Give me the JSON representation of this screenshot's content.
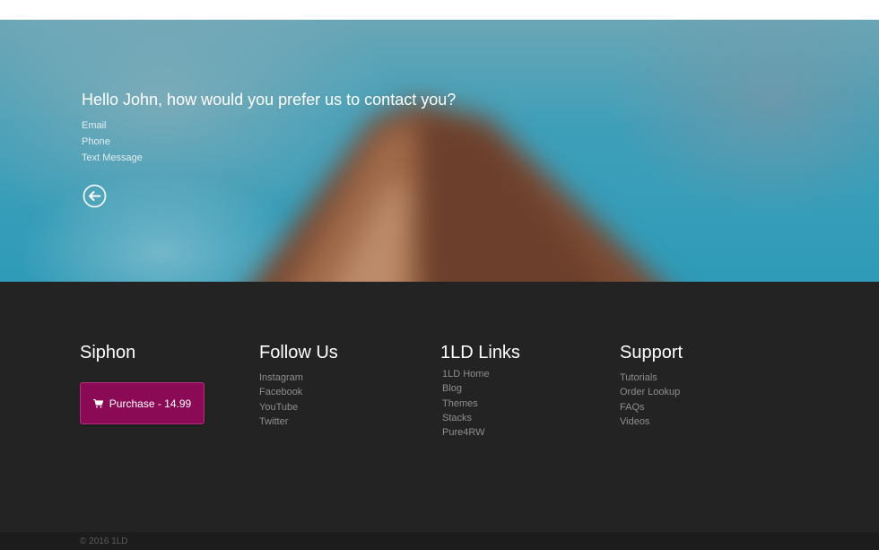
{
  "hero": {
    "title": "Hello John, how would you prefer us to contact you?",
    "options": [
      "Email",
      "Phone",
      "Text Message"
    ],
    "back_icon": "arrow-left-circle-icon"
  },
  "footer": {
    "brand": {
      "title": "Siphon",
      "purchase_label": "Purchase - 14.99",
      "purchase_icon": "cart-icon",
      "button_color": "#8a0a56"
    },
    "follow": {
      "title": "Follow Us",
      "links": [
        "Instagram",
        "Facebook",
        "YouTube",
        "Twitter"
      ]
    },
    "links": {
      "title": "1LD Links",
      "links": [
        "1LD Home",
        "Blog",
        "Themes",
        "Stacks",
        "Pure4RW"
      ]
    },
    "support": {
      "title": "Support",
      "links": [
        "Tutorials",
        "Order Lookup",
        "FAQs",
        "Videos"
      ]
    },
    "copyright": "© 2016 1LD"
  }
}
